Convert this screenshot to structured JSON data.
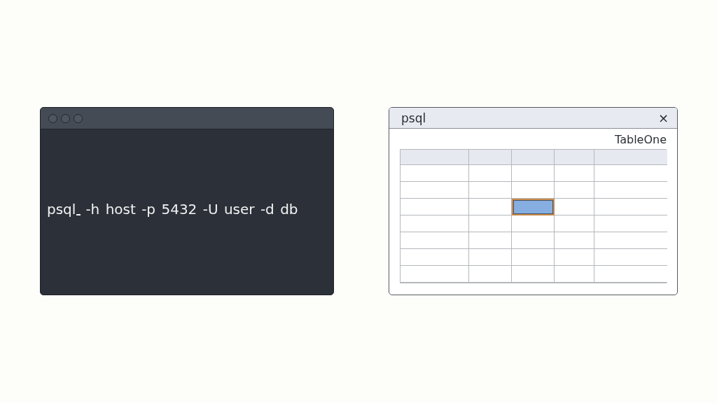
{
  "terminal": {
    "command_before_cursor": "psql",
    "command_after_cursor": "-h host -p 5432 -U user -d db"
  },
  "table_window": {
    "title": "psql",
    "close": "×",
    "table_name": "TableOne",
    "rows": [
      {
        "kind": "header",
        "cells": [
          {
            "selected": false
          },
          {
            "selected": false
          },
          {
            "selected": false
          },
          {
            "selected": false
          },
          {
            "selected": false
          }
        ]
      },
      {
        "kind": "body",
        "cells": [
          {
            "selected": false
          },
          {
            "selected": false
          },
          {
            "selected": false
          },
          {
            "selected": false
          },
          {
            "selected": false
          }
        ]
      },
      {
        "kind": "body",
        "cells": [
          {
            "selected": false
          },
          {
            "selected": false
          },
          {
            "selected": false
          },
          {
            "selected": false
          },
          {
            "selected": false
          }
        ]
      },
      {
        "kind": "body",
        "cells": [
          {
            "selected": false
          },
          {
            "selected": false
          },
          {
            "selected": true
          },
          {
            "selected": false
          },
          {
            "selected": false
          }
        ]
      },
      {
        "kind": "body",
        "cells": [
          {
            "selected": false
          },
          {
            "selected": false
          },
          {
            "selected": false
          },
          {
            "selected": false
          },
          {
            "selected": false
          }
        ]
      },
      {
        "kind": "body",
        "cells": [
          {
            "selected": false
          },
          {
            "selected": false
          },
          {
            "selected": false
          },
          {
            "selected": false
          },
          {
            "selected": false
          }
        ]
      },
      {
        "kind": "body",
        "cells": [
          {
            "selected": false
          },
          {
            "selected": false
          },
          {
            "selected": false
          },
          {
            "selected": false
          },
          {
            "selected": false
          }
        ]
      },
      {
        "kind": "body",
        "cells": [
          {
            "selected": false
          },
          {
            "selected": false
          },
          {
            "selected": false
          },
          {
            "selected": false
          },
          {
            "selected": false
          }
        ]
      }
    ]
  }
}
